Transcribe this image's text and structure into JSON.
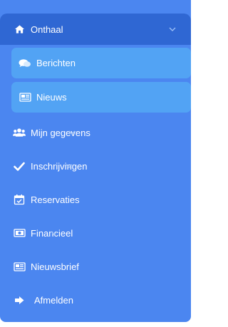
{
  "sidebar": {
    "items": [
      {
        "label": "Onthaal",
        "icon": "home-icon",
        "expandable": true,
        "active": true
      },
      {
        "label": "Berichten",
        "icon": "comments-icon",
        "submenu_of": "Onthaal"
      },
      {
        "label": "Nieuws",
        "icon": "newspaper-icon",
        "submenu_of": "Onthaal"
      },
      {
        "label": "Mijn gegevens",
        "icon": "users-icon",
        "expandable": true
      },
      {
        "label": "Inschrijvingen",
        "icon": "checkmark-icon",
        "expandable": true
      },
      {
        "label": "Reservaties",
        "icon": "calendar-check-icon"
      },
      {
        "label": "Financieel",
        "icon": "money-bill-icon",
        "expandable": true
      },
      {
        "label": "Nieuwsbrief",
        "icon": "newspaper-icon"
      },
      {
        "label": "Afmelden",
        "icon": "sign-out-icon"
      }
    ]
  },
  "colors": {
    "sidebar_bg": "#4b86f0",
    "active_bg": "#2f67d3",
    "submenu_bg": "#52a3f4",
    "text": "#ffffff"
  }
}
